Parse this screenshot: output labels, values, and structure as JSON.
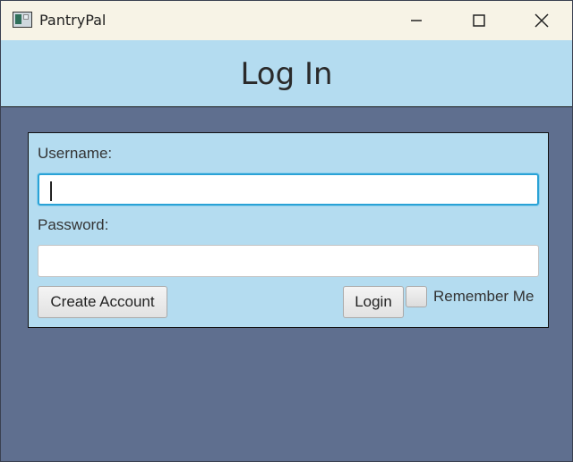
{
  "window": {
    "title": "PantryPal",
    "icons": {
      "app": "app-icon",
      "minimize": "minimize-icon",
      "maximize": "maximize-icon",
      "close": "close-icon"
    }
  },
  "header": {
    "title": "Log In"
  },
  "form": {
    "username_label": "Username:",
    "username_value": "",
    "password_label": "Password:",
    "password_value": "",
    "create_account_label": "Create Account",
    "login_label": "Login",
    "remember_me_label": "Remember Me",
    "remember_me_checked": false
  },
  "colors": {
    "header_bg": "#b4dcf0",
    "body_bg": "#5f6f8f",
    "focus_border": "#2aa2d6"
  }
}
